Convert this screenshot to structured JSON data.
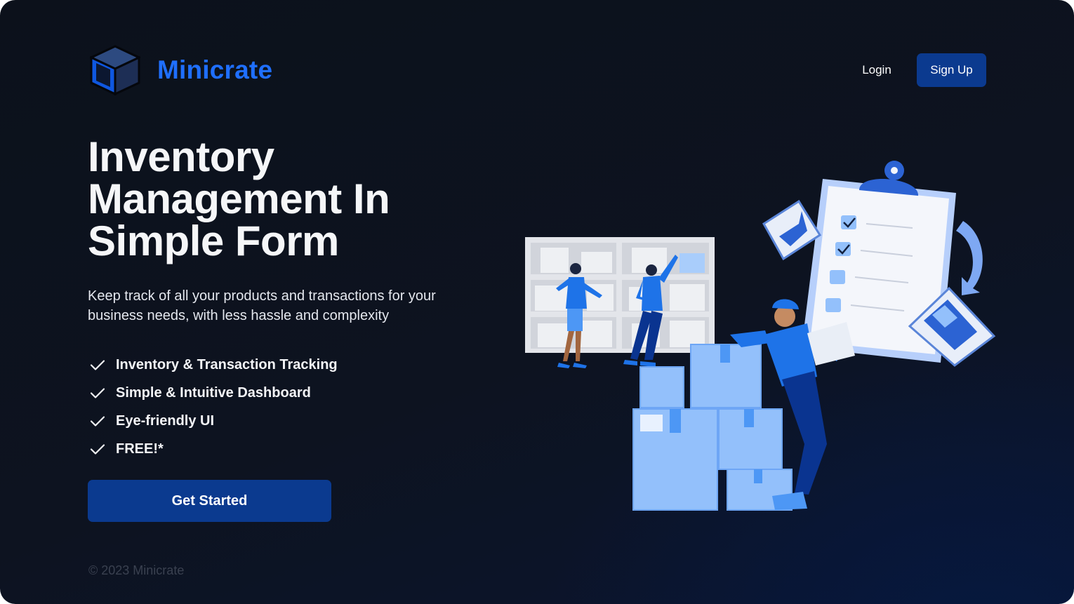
{
  "header": {
    "brand": "Minicrate",
    "logo_icon": "crate-icon",
    "login_label": "Login",
    "signup_label": "Sign Up"
  },
  "hero": {
    "headline": "Inventory Management In Simple Form",
    "subtext": "Keep track of all your products and transactions for your business needs, with less hassle and complexity",
    "features": [
      {
        "icon": "check-icon",
        "label": "Inventory & Transaction Tracking"
      },
      {
        "icon": "check-icon",
        "label": "Simple & Intuitive Dashboard"
      },
      {
        "icon": "check-icon",
        "label": "Eye-friendly UI"
      },
      {
        "icon": "check-icon",
        "label": "FREE!*"
      }
    ],
    "cta_label": "Get Started"
  },
  "footer": {
    "copyright": "© 2023 Minicrate"
  },
  "colors": {
    "background": "#0c111b",
    "brand_blue": "#1f6fff",
    "button_blue": "#0b3a8f",
    "illustration_light_blue": "#93c0fb",
    "illustration_accent": "#1e73e8"
  }
}
